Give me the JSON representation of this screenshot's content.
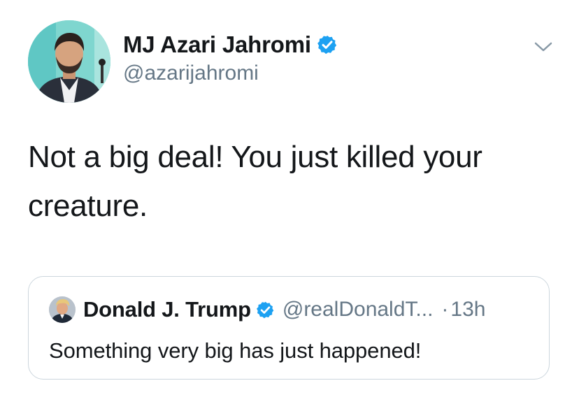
{
  "tweet": {
    "author": {
      "display_name": "MJ Azari Jahromi",
      "handle": "@azarijahromi",
      "verified": true
    },
    "text": "Not a big deal! You just killed your creature.",
    "menu_icon": "chevron-down-icon"
  },
  "quoted_tweet": {
    "author": {
      "display_name": "Donald J. Trump",
      "handle": "@realDonaldT...",
      "verified": true
    },
    "separator": "·",
    "time": "13h",
    "text": "Something very big has just happened!"
  },
  "colors": {
    "verified_blue": "#1da1f2",
    "secondary_text": "#657786",
    "primary_text": "#14171a",
    "border": "#ccd6dd"
  }
}
